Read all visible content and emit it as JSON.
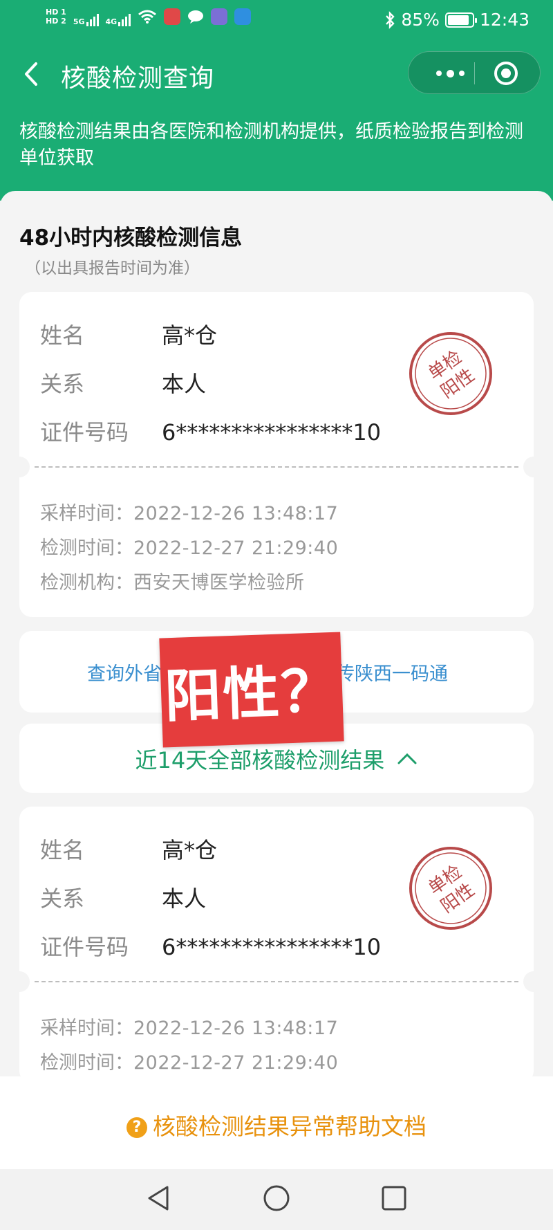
{
  "status_bar": {
    "hd1": "HD 1",
    "hd2": "HD 2",
    "net1": "5G",
    "net2": "4G",
    "battery": "85%",
    "time": "12:43"
  },
  "navbar": {
    "title": "核酸检测查询"
  },
  "notice": "核酸检测结果由各医院和检测机构提供，纸质检验报告到检测单位获取",
  "section": {
    "title": "48小时内核酸检测信息",
    "subtitle": "（以出具报告时间为准）"
  },
  "labels": {
    "name": "姓名",
    "relation": "关系",
    "id": "证件号码",
    "sample_time": "采样时间：",
    "test_time": "检测时间：",
    "institution": "检测机构："
  },
  "stamp_text": [
    "单检",
    "阳性"
  ],
  "record1": {
    "name": "高*仓",
    "relation": "本人",
    "id": "6****************10",
    "sample_time": "2022-12-26 13:48:17",
    "test_time": "2022-12-27 21:29:40",
    "institution": "西安天博医学检验所"
  },
  "links": {
    "left": "查询外省",
    "right": "传陕西一码通"
  },
  "overlay_label": "阳性？",
  "toggle_label": "近14天全部核酸检测结果",
  "record2": {
    "name": "高*仓",
    "relation": "本人",
    "id": "6****************10",
    "sample_time": "2022-12-26 13:48:17",
    "test_time": "2022-12-27 21:29:40"
  },
  "help_label": "核酸检测结果异常帮助文档",
  "help_icon_glyph": "?",
  "colors": {
    "header_green": "#1aad74",
    "link_blue": "#3a8fcf",
    "toggle_green": "#1d9e6a",
    "help_orange": "#e8920e",
    "stamp_red": "#b84a4a",
    "overlay_red": "#e53d3d"
  }
}
